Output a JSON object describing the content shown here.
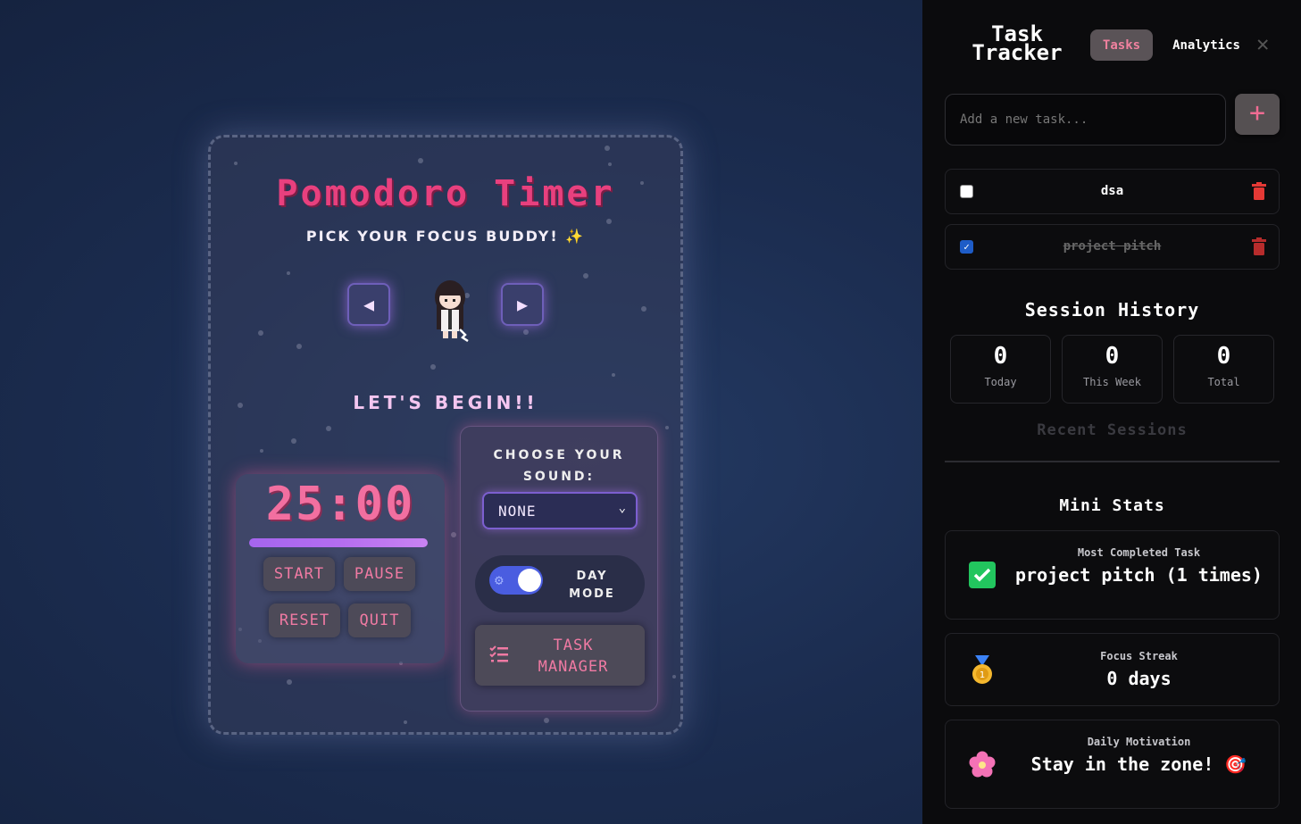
{
  "pomodoro": {
    "title": "Pomodoro Timer",
    "subtitle": "PICK YOUR FOCUS BUDDY! ✨",
    "prev_icon": "◀",
    "next_icon": "▶",
    "status": "LET'S BEGIN!!",
    "timer": "25:00",
    "progress": 1.0,
    "buttons": {
      "start": "START",
      "pause": "PAUSE",
      "reset": "RESET",
      "quit": "QUIT"
    }
  },
  "sound": {
    "title": "CHOOSE YOUR SOUND:",
    "selected": "NONE",
    "toggle_label": "DAY MODE",
    "toggle_on": true,
    "task_manager": "TASK MANAGER"
  },
  "panel": {
    "title": "Task Tracker",
    "tabs": [
      "Tasks",
      "Analytics"
    ],
    "active_tab": "Tasks",
    "close": "✕",
    "input_placeholder": "Add a new task...",
    "add_label": "+",
    "tasks": [
      {
        "name": "dsa",
        "done": false
      },
      {
        "name": "project pitch",
        "done": true
      }
    ],
    "session_title": "Session History",
    "stats": [
      {
        "value": "0",
        "label": "Today"
      },
      {
        "value": "0",
        "label": "This Week"
      },
      {
        "value": "0",
        "label": "Total"
      }
    ],
    "recent_title": "Recent Sessions",
    "mini_title": "Mini Stats",
    "mini": [
      {
        "icon": "check-mark-icon",
        "label": "Most Completed Task",
        "value": "project pitch (1 times)"
      },
      {
        "icon": "medal-icon",
        "label": "Focus Streak",
        "value": "0 days"
      },
      {
        "icon": "flower-icon",
        "label": "Daily Motivation",
        "value": "Stay in the zone! 🎯"
      }
    ]
  },
  "colors": {
    "accent_pink": "#e8407e",
    "accent_purple": "#a565ee",
    "panel_bg": "#0b0b0d",
    "toggle_blue": "#4a5de0"
  }
}
